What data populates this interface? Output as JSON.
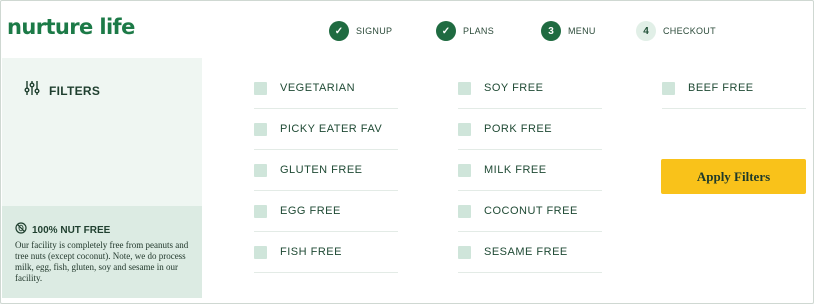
{
  "brand": {
    "logo_text": "nurture life",
    "color": "#1c7a47"
  },
  "steps": [
    {
      "marker": "✓",
      "label": "SIGNUP",
      "state": "complete"
    },
    {
      "marker": "✓",
      "label": "PLANS",
      "state": "complete"
    },
    {
      "marker": "3",
      "label": "MENU",
      "state": "current"
    },
    {
      "marker": "4",
      "label": "CHECKOUT",
      "state": "upcoming"
    }
  ],
  "sidebar": {
    "filters_label": "FILTERS",
    "nut_free": {
      "title": "100% NUT FREE",
      "text": "Our facility is completely free from peanuts and tree nuts (except coconut). Note, we do process milk, egg, fish, gluten, soy and sesame in our facility."
    }
  },
  "filters": {
    "column_1": [
      "VEGETARIAN",
      "PICKY EATER FAV",
      "GLUTEN FREE",
      "EGG FREE",
      "FISH FREE"
    ],
    "column_2": [
      "SOY FREE",
      "PORK FREE",
      "MILK FREE",
      "COCONUT FREE",
      "SESAME FREE"
    ],
    "column_3": [
      "BEEF FREE"
    ]
  },
  "apply_button": {
    "label": "Apply Filters",
    "color": "#f9c21a"
  },
  "colors": {
    "primary": "#1f6b41",
    "sidebar_bg": "#eff6f2",
    "notice_bg": "#dcebe3",
    "checkbox": "#cfe5da"
  }
}
